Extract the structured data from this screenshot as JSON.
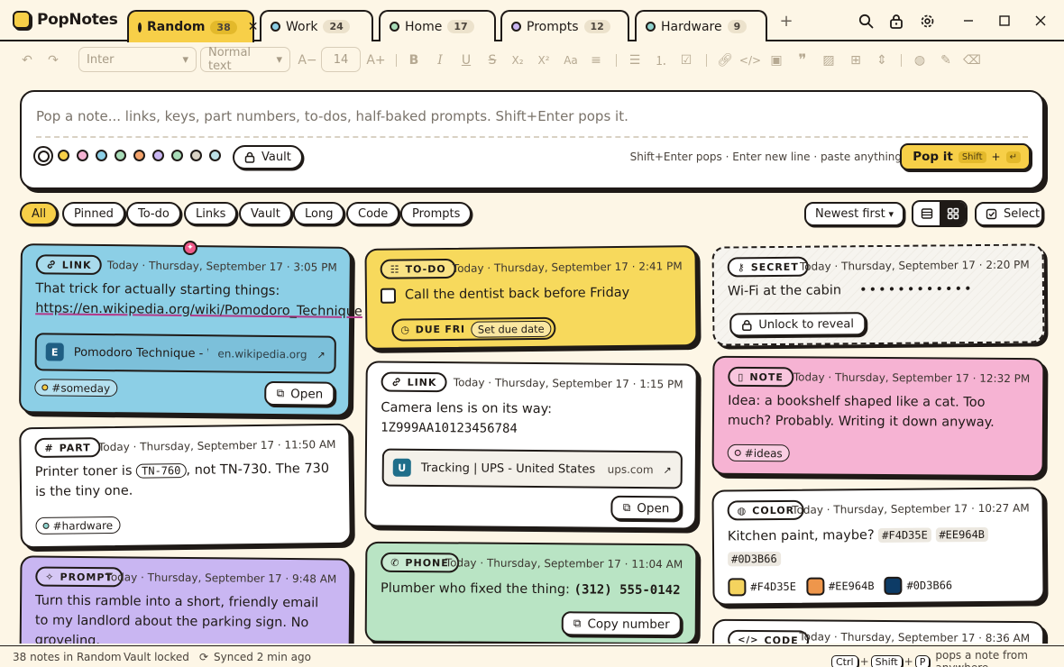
{
  "app": {
    "name": "PopNotes"
  },
  "tabs": [
    {
      "label": "Random",
      "count": "38",
      "color": "#f7cf48",
      "active": true
    },
    {
      "label": "Work",
      "count": "24",
      "color": "#8ccfe6"
    },
    {
      "label": "Home",
      "count": "17",
      "color": "#a8dcb8"
    },
    {
      "label": "Prompts",
      "count": "12",
      "color": "#c9b6f2"
    },
    {
      "label": "Hardware",
      "count": "9",
      "color": "#8fd2cd"
    }
  ],
  "toolbar": {
    "font": "Inter",
    "style": "Normal text",
    "size": "14"
  },
  "composer": {
    "placeholder": "Pop a note... links, keys, part numbers, to-dos, half-baked prompts. Shift+Enter pops it.",
    "swatches": [
      "#ffffff",
      "#f7cf48",
      "#f6b3d3",
      "#8ccfe6",
      "#a8dcb8",
      "#f4a36b",
      "#c9b6f2",
      "#a8dcb8",
      "#d9d2c4",
      "#bde0e6"
    ],
    "vault_label": "Vault",
    "hint": "Shift+Enter pops · Enter new line · paste anything",
    "pop_label": "Pop it",
    "pop_key": "Shift",
    "pop_plus": "+",
    "pop_enter": "↵"
  },
  "filters": [
    "All",
    "Pinned",
    "To-do",
    "Links",
    "Vault",
    "Long",
    "Code",
    "Prompts"
  ],
  "sort_label": "Newest first",
  "select_label": "Select",
  "cards": {
    "link1": {
      "badge": "LINK",
      "time": "Today · Thursday, September 17 · 3:05 PM",
      "text": "That trick for actually starting things:",
      "url": "https://en.wikipedia.org/wiki/Pomodoro_Technique",
      "preview_icon": "E",
      "preview_title": "Pomodoro Technique - Wi...",
      "preview_domain": "en.wikipedia.org",
      "tag": "#someday",
      "tag_color": "#f7cf48",
      "action": "Open"
    },
    "part": {
      "badge": "PART",
      "time": "Today · Thursday, September 17 · 11:50 AM",
      "text_a": "Printer toner is",
      "code": "TN-760",
      "text_b": ", not TN-730. The 730 is the tiny one.",
      "tag": "#hardware",
      "tag_color": "#8fd2cd"
    },
    "prompt": {
      "badge": "PROMPT",
      "time": "Today · Thursday, September 17 · 9:48 AM",
      "text": "Turn this ramble into a short, friendly email to my landlord about the parking sign. No groveling."
    },
    "todo": {
      "badge": "TO-DO",
      "time": "Today · Thursday, September 17 · 2:41 PM",
      "text": "Call the dentist back before Friday",
      "due": "DUE FRI",
      "due_action": "Set due date"
    },
    "link2": {
      "badge": "LINK",
      "time": "Today · Thursday, September 17 · 1:15 PM",
      "text": "Camera lens is on its way:",
      "tracking": "1Z999AA10123456784",
      "preview_icon": "U",
      "preview_title": "Tracking | UPS - United States",
      "preview_domain": "ups.com",
      "action": "Open"
    },
    "phone": {
      "badge": "PHONE",
      "time": "Today · Thursday, September 17 · 11:04 AM",
      "text": "Plumber who fixed the thing:",
      "number": "(312) 555-0142",
      "action": "Copy number"
    },
    "secret": {
      "badge": "SECRET",
      "time": "Today · Thursday, September 17 · 2:20 PM",
      "text": "Wi-Fi at the cabin",
      "masked": "••••••••••••",
      "action": "Unlock to reveal"
    },
    "note": {
      "badge": "NOTE",
      "time": "Today · Thursday, September 17 · 12:32 PM",
      "text": "Idea: a bookshelf shaped like a cat. Too much? Probably. Writing it down anyway.",
      "tag": "#ideas",
      "tag_color": "#f6b3d3"
    },
    "color": {
      "badge": "COLOR",
      "time": "Today · Thursday, September 17 · 10:27 AM",
      "text": "Kitchen paint, maybe?",
      "hexes": [
        "#F4D35E",
        "#EE964B",
        "#0D3B66"
      ]
    },
    "code": {
      "badge": "CODE",
      "time": "Today · Thursday, September 17 · 8:36 AM"
    }
  },
  "status": {
    "count": "38 notes in Random",
    "vault": "Vault locked",
    "sync": "Synced 2 min ago",
    "k1": "Ctrl",
    "k2": "Shift",
    "k3": "P",
    "plus": "+",
    "shortcut_text": "pops a note from anywhere"
  }
}
